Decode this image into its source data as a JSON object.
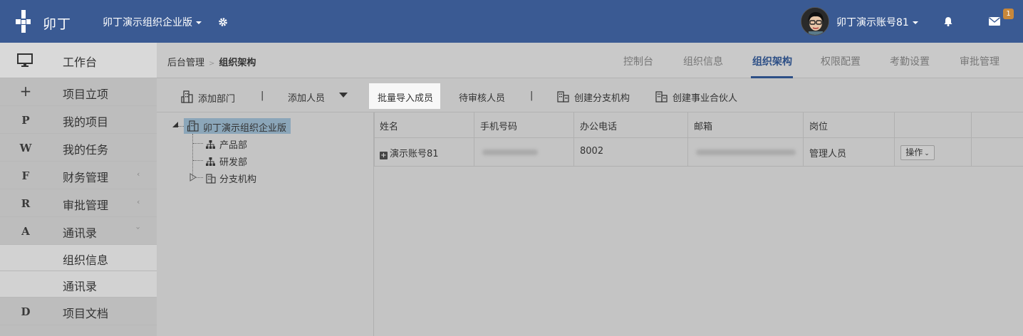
{
  "header": {
    "logo_text": "卯丁",
    "org_name": "卯丁演示组织企业版",
    "user_name": "卯丁演示账号81",
    "mail_badge": "1",
    "colors": {
      "topbar": "#3a5a93",
      "badge": "#c8873a"
    }
  },
  "sidebar": {
    "items": [
      {
        "icon": "monitor-icon",
        "label": "工作台"
      },
      {
        "icon": "plus-icon",
        "label": "项目立项"
      },
      {
        "icon": "P",
        "label": "我的项目"
      },
      {
        "icon": "W",
        "label": "我的任务"
      },
      {
        "icon": "F",
        "label": "财务管理"
      },
      {
        "icon": "R",
        "label": "审批管理"
      },
      {
        "icon": "A",
        "label": "通讯录"
      },
      {
        "icon": "",
        "label": "组织信息"
      },
      {
        "icon": "",
        "label": "通讯录"
      },
      {
        "icon": "D",
        "label": "项目文档"
      }
    ],
    "arrow_collapsed": "‹",
    "arrow_expanded": "›"
  },
  "breadcrumb": {
    "root": "后台管理",
    "current": "组织架构"
  },
  "tabs": [
    "控制台",
    "组织信息",
    "组织架构",
    "权限配置",
    "考勤设置",
    "审批管理"
  ],
  "active_tab": "组织架构",
  "toolbar": {
    "add_dept": "添加部门",
    "add_person": "添加人员",
    "bulk_import": "批量导入成员",
    "pending_review": "待审核人员",
    "create_branch": "创建分支机构",
    "create_partner": "创建事业合伙人",
    "separator": "|"
  },
  "tree": {
    "root": "卯丁演示组织企业版",
    "children": [
      "产品部",
      "研发部",
      "分支机构"
    ]
  },
  "table": {
    "columns": [
      "姓名",
      "手机号码",
      "办公电话",
      "邮箱",
      "岗位"
    ],
    "rows": [
      {
        "name": "演示账号81",
        "office_phone": "8002",
        "position": "管理人员",
        "action": "操作"
      }
    ]
  }
}
